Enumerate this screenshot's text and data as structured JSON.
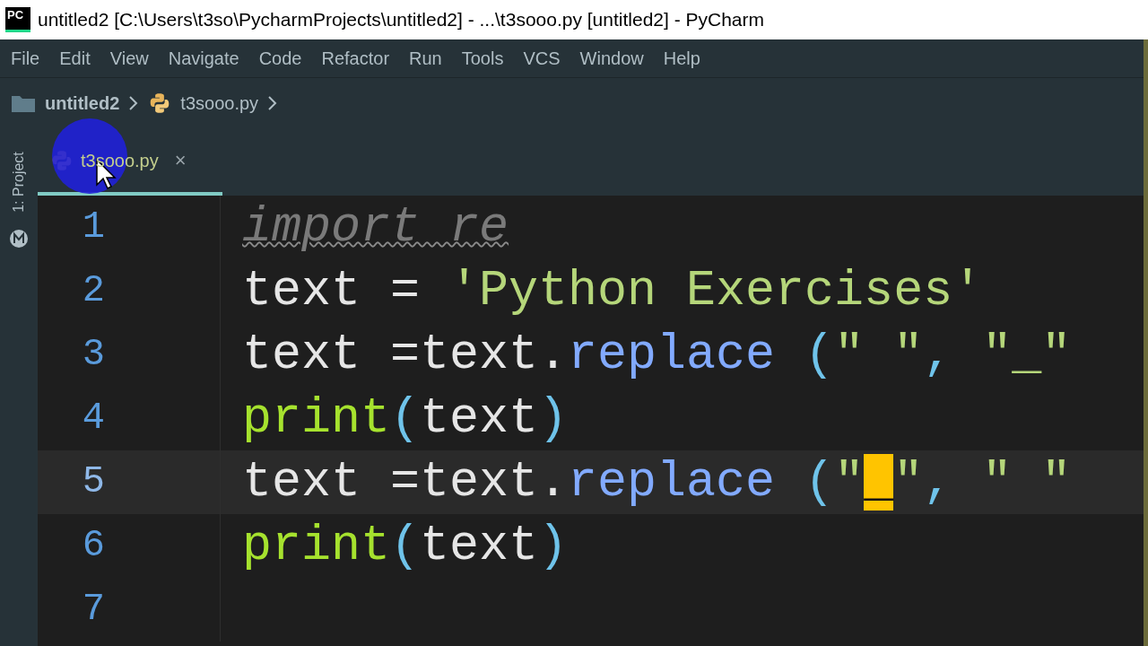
{
  "window": {
    "title": "untitled2 [C:\\Users\\t3so\\PycharmProjects\\untitled2] - ...\\t3sooo.py [untitled2] - PyCharm",
    "app_icon": "PC"
  },
  "menu": [
    "File",
    "Edit",
    "View",
    "Navigate",
    "Code",
    "Refactor",
    "Run",
    "Tools",
    "VCS",
    "Window",
    "Help"
  ],
  "breadcrumb": [
    {
      "label": "untitled2",
      "kind": "folder"
    },
    {
      "label": "t3sooo.py",
      "kind": "python"
    }
  ],
  "sidebar": {
    "label": "1: Project"
  },
  "tabs": [
    {
      "label": "t3sooo.py",
      "selected": true,
      "close": "×"
    }
  ],
  "editor": {
    "lines": [
      {
        "number": "1",
        "current": false,
        "tokens": [
          {
            "kind": "unused",
            "text": "import re"
          }
        ]
      },
      {
        "number": "2",
        "current": false,
        "tokens": [
          {
            "kind": "plain",
            "text": "text = "
          },
          {
            "kind": "string",
            "text": "'Python Exercises'"
          }
        ]
      },
      {
        "number": "3",
        "current": false,
        "tokens": [
          {
            "kind": "plain",
            "text": "text =text."
          },
          {
            "kind": "func",
            "text": "replace "
          },
          {
            "kind": "paren",
            "text": "("
          },
          {
            "kind": "string",
            "text": "\" \""
          },
          {
            "kind": "paren",
            "text": ", "
          },
          {
            "kind": "string",
            "text": "\"_\""
          }
        ]
      },
      {
        "number": "4",
        "current": false,
        "tokens": [
          {
            "kind": "builtin",
            "text": "print"
          },
          {
            "kind": "paren",
            "text": "("
          },
          {
            "kind": "plain",
            "text": "text"
          },
          {
            "kind": "paren",
            "text": ")"
          }
        ]
      },
      {
        "number": "5",
        "current": true,
        "tokens": [
          {
            "kind": "plain",
            "text": "text =text."
          },
          {
            "kind": "func",
            "text": "replace "
          },
          {
            "kind": "paren",
            "text": "("
          },
          {
            "kind": "string",
            "text": "\""
          },
          {
            "kind": "caret",
            "text": "_"
          },
          {
            "kind": "string",
            "text": "\""
          },
          {
            "kind": "paren",
            "text": ", "
          },
          {
            "kind": "string",
            "text": "\" \""
          }
        ]
      },
      {
        "number": "6",
        "current": false,
        "tokens": [
          {
            "kind": "builtin",
            "text": "print"
          },
          {
            "kind": "paren",
            "text": "("
          },
          {
            "kind": "plain",
            "text": "text"
          },
          {
            "kind": "paren",
            "text": ")"
          }
        ]
      },
      {
        "number": "7",
        "current": false
      }
    ]
  }
}
